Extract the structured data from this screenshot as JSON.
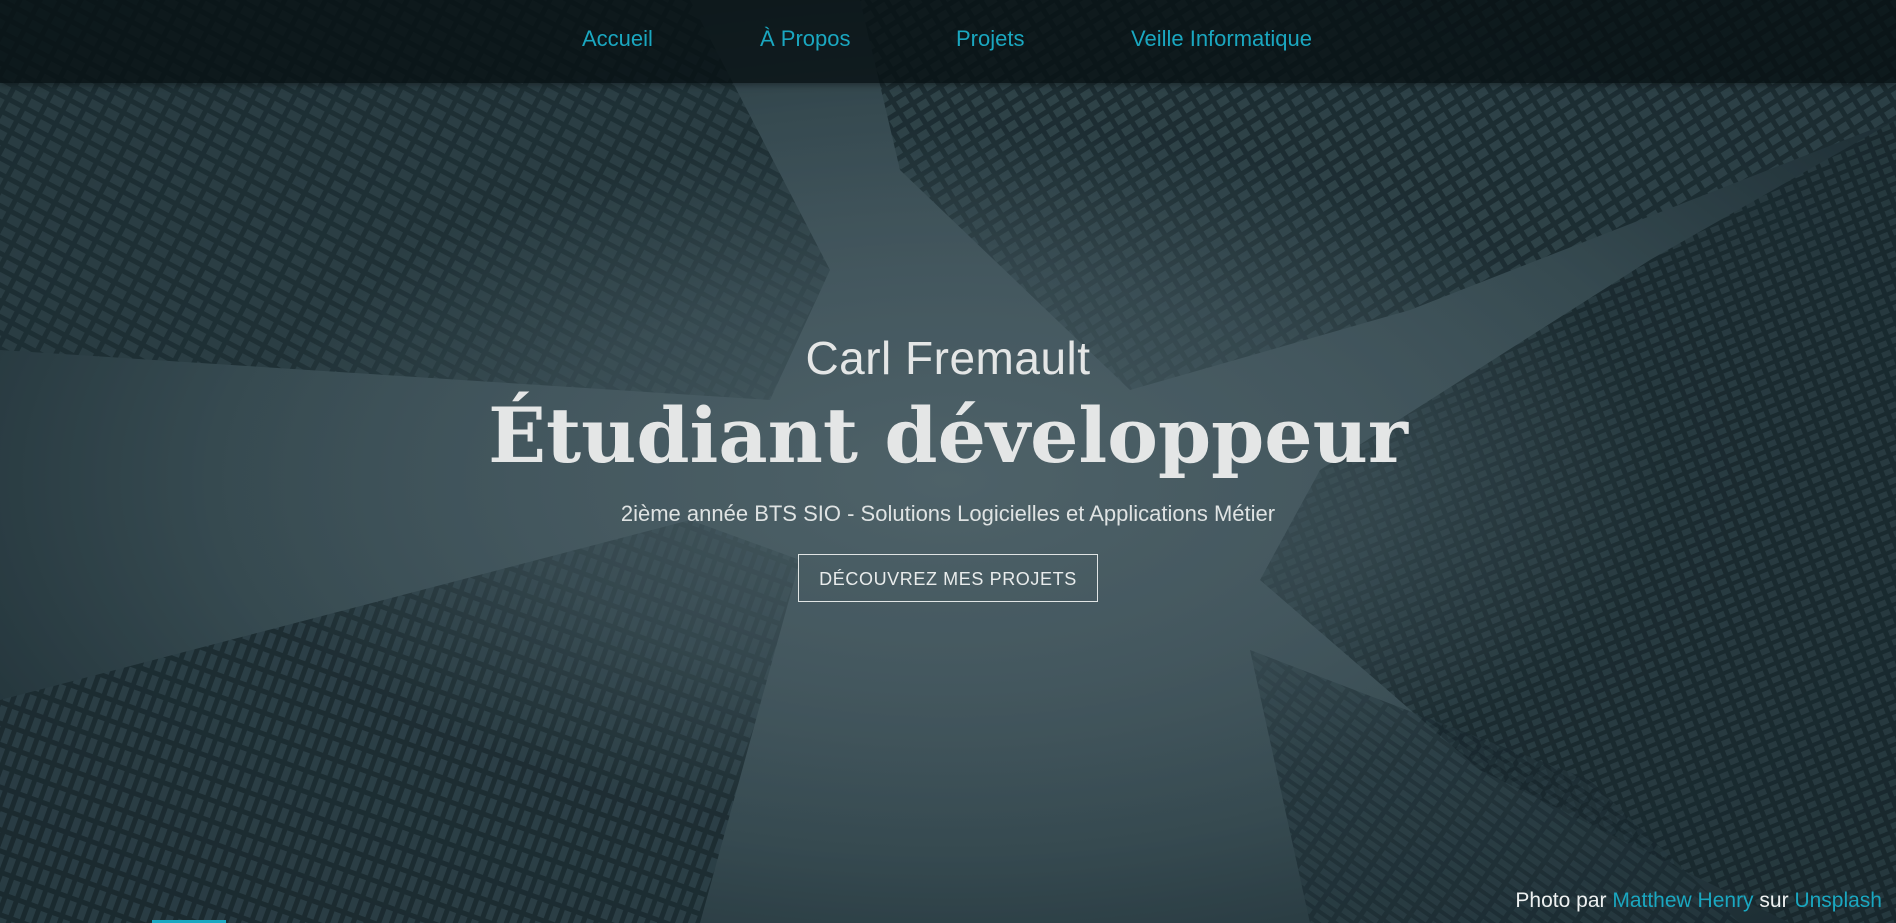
{
  "nav": {
    "items": [
      {
        "label": "Accueil"
      },
      {
        "label": "À Propos"
      },
      {
        "label": "Projets"
      },
      {
        "label": "Veille Informatique"
      }
    ]
  },
  "hero": {
    "name": "Carl Fremault",
    "headline": "Étudiant développeur",
    "subtitle": "2ième année BTS SIO - Solutions Logicielles et Applications Métier",
    "cta_label": "DÉCOUVREZ MES PROJETS"
  },
  "credit": {
    "prefix": "Photo par",
    "author": "Matthew Henry",
    "middle": "sur",
    "site": "Unsplash"
  },
  "colors": {
    "accent": "#1aa7c0",
    "text": "#e4e6e6",
    "navbar": "#061012"
  }
}
